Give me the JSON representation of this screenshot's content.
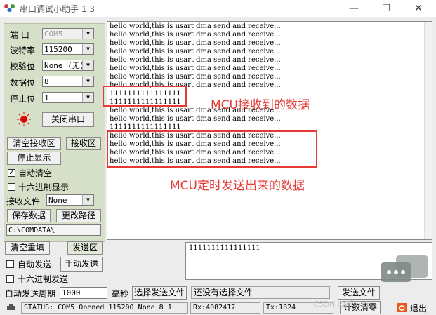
{
  "window": {
    "title": "串口调试小助手 1.3",
    "minimize_glyph": "—",
    "maximize_glyph": "☐",
    "close_glyph": "✕"
  },
  "port": {
    "port_label": "端  口",
    "port_value": "COM5",
    "baud_label": "波特率",
    "baud_value": "115200",
    "parity_label": "校验位",
    "parity_value": "None (无)",
    "databits_label": "数据位",
    "databits_value": "8",
    "stopbits_label": "停止位",
    "stopbits_value": "1",
    "status_led_color": "#e00000",
    "toggle_button": "关闭串口"
  },
  "rx_controls": {
    "clear_rx": "清空接收区",
    "rx_area_label": "接收区",
    "stop_display": "停止显示",
    "auto_clear_label": "自动清空",
    "auto_clear_checked": true,
    "auto_clear_mark": "✓",
    "hex_display_label": "十六进制显示",
    "hex_display_checked": false,
    "rx_file_label": "接收文件",
    "rx_file_value": "None",
    "save_data": "保存数据",
    "change_path": "更改路径",
    "path_value": "C:\\COMDATA\\"
  },
  "receive_area": {
    "lines": [
      "hello world,this is usart dma send and receive...",
      "hello world,this is usart dma send and receive...",
      "hello world,this is usart dma send and receive...",
      "hello world,this is usart dma send and receive...",
      "hello world,this is usart dma send and receive...",
      "hello world,this is usart dma send and receive...",
      "hello world,this is usart dma send and receive...",
      "hello world,this is usart dma send and receive...",
      "1111111111111111",
      "1111111111111111",
      "hello world,this is usart dma send and receive...",
      "hello world,this is usart dma send and receive...",
      "1111111111111111",
      "hello world,this is usart dma send and receive...",
      "hello world,this is usart dma send and receive...",
      "hello world,this is usart dma send and receive...",
      "hello world,this is usart dma send and receive..."
    ]
  },
  "annotations": {
    "received_label": "MCU接收到的数据",
    "sent_label": "MCU定时发送出来的数据",
    "color": "#e53935"
  },
  "tx_controls": {
    "clear_resend": "清空重填",
    "tx_area_label": "发送区",
    "auto_send_label": "自动发送",
    "auto_send_checked": false,
    "manual_send": "手动发送",
    "hex_send_label": "十六进制发送",
    "hex_send_checked": false,
    "period_label": "自动发送周期",
    "period_value": "1000",
    "period_unit": "毫秒",
    "choose_file": "选择发送文件",
    "no_file_text": "还没有选择文件",
    "send_file": "发送文件",
    "tx_text": "1111111111111111"
  },
  "status_bar": {
    "status": "STATUS: COM5 Opened 115200 None  8 1",
    "rx": "Rx:4082417",
    "tx": "Tx:1824",
    "reset_count": "计数清零",
    "exit": "退出"
  },
  "watermark": "CSDN @新川zy"
}
